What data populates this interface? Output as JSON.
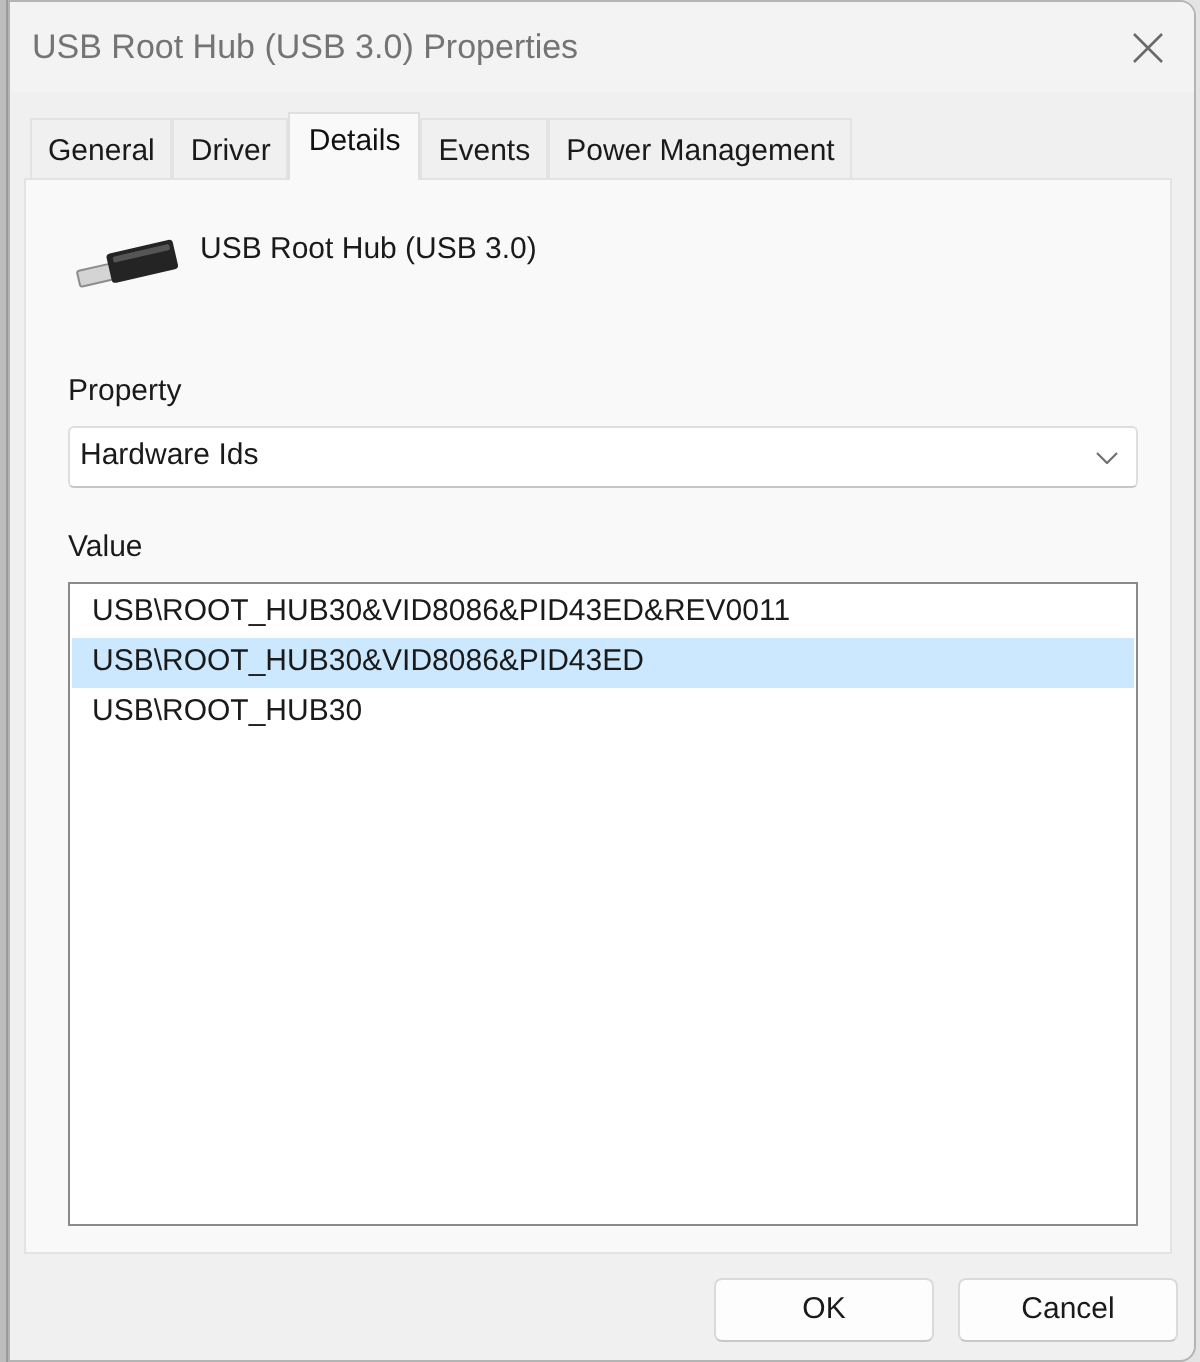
{
  "window": {
    "title": "USB Root Hub (USB 3.0) Properties"
  },
  "tabs": [
    {
      "label": "General",
      "selected": false
    },
    {
      "label": "Driver",
      "selected": false
    },
    {
      "label": "Details",
      "selected": true
    },
    {
      "label": "Events",
      "selected": false
    },
    {
      "label": "Power Management",
      "selected": false
    }
  ],
  "device": {
    "name": "USB Root Hub (USB 3.0)"
  },
  "property": {
    "label": "Property",
    "value": "Hardware Ids"
  },
  "value_list": {
    "label": "Value",
    "items": [
      {
        "text": "USB\\ROOT_HUB30&VID8086&PID43ED&REV0011",
        "selected": false
      },
      {
        "text": "USB\\ROOT_HUB30&VID8086&PID43ED",
        "selected": true
      },
      {
        "text": "USB\\ROOT_HUB30",
        "selected": false
      }
    ]
  },
  "buttons": [
    {
      "label": "OK"
    },
    {
      "label": "Cancel"
    }
  ]
}
